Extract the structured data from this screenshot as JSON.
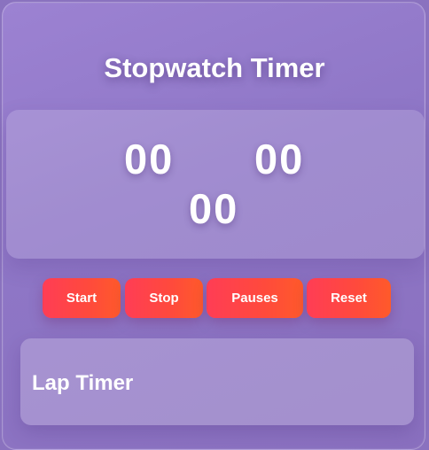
{
  "app": {
    "title": "Stopwatch Timer"
  },
  "display": {
    "hours": "00",
    "minutes": "00",
    "seconds": "00"
  },
  "controls": {
    "start_label": "Start",
    "stop_label": "Stop",
    "pauses_label": "Pauses",
    "reset_label": "Reset"
  },
  "lap": {
    "title": "Lap Timer"
  },
  "colors": {
    "background": "#8a72bf",
    "button_gradient_start": "#ff3d55",
    "button_gradient_end": "#ff5a2a",
    "text": "#ffffff"
  }
}
